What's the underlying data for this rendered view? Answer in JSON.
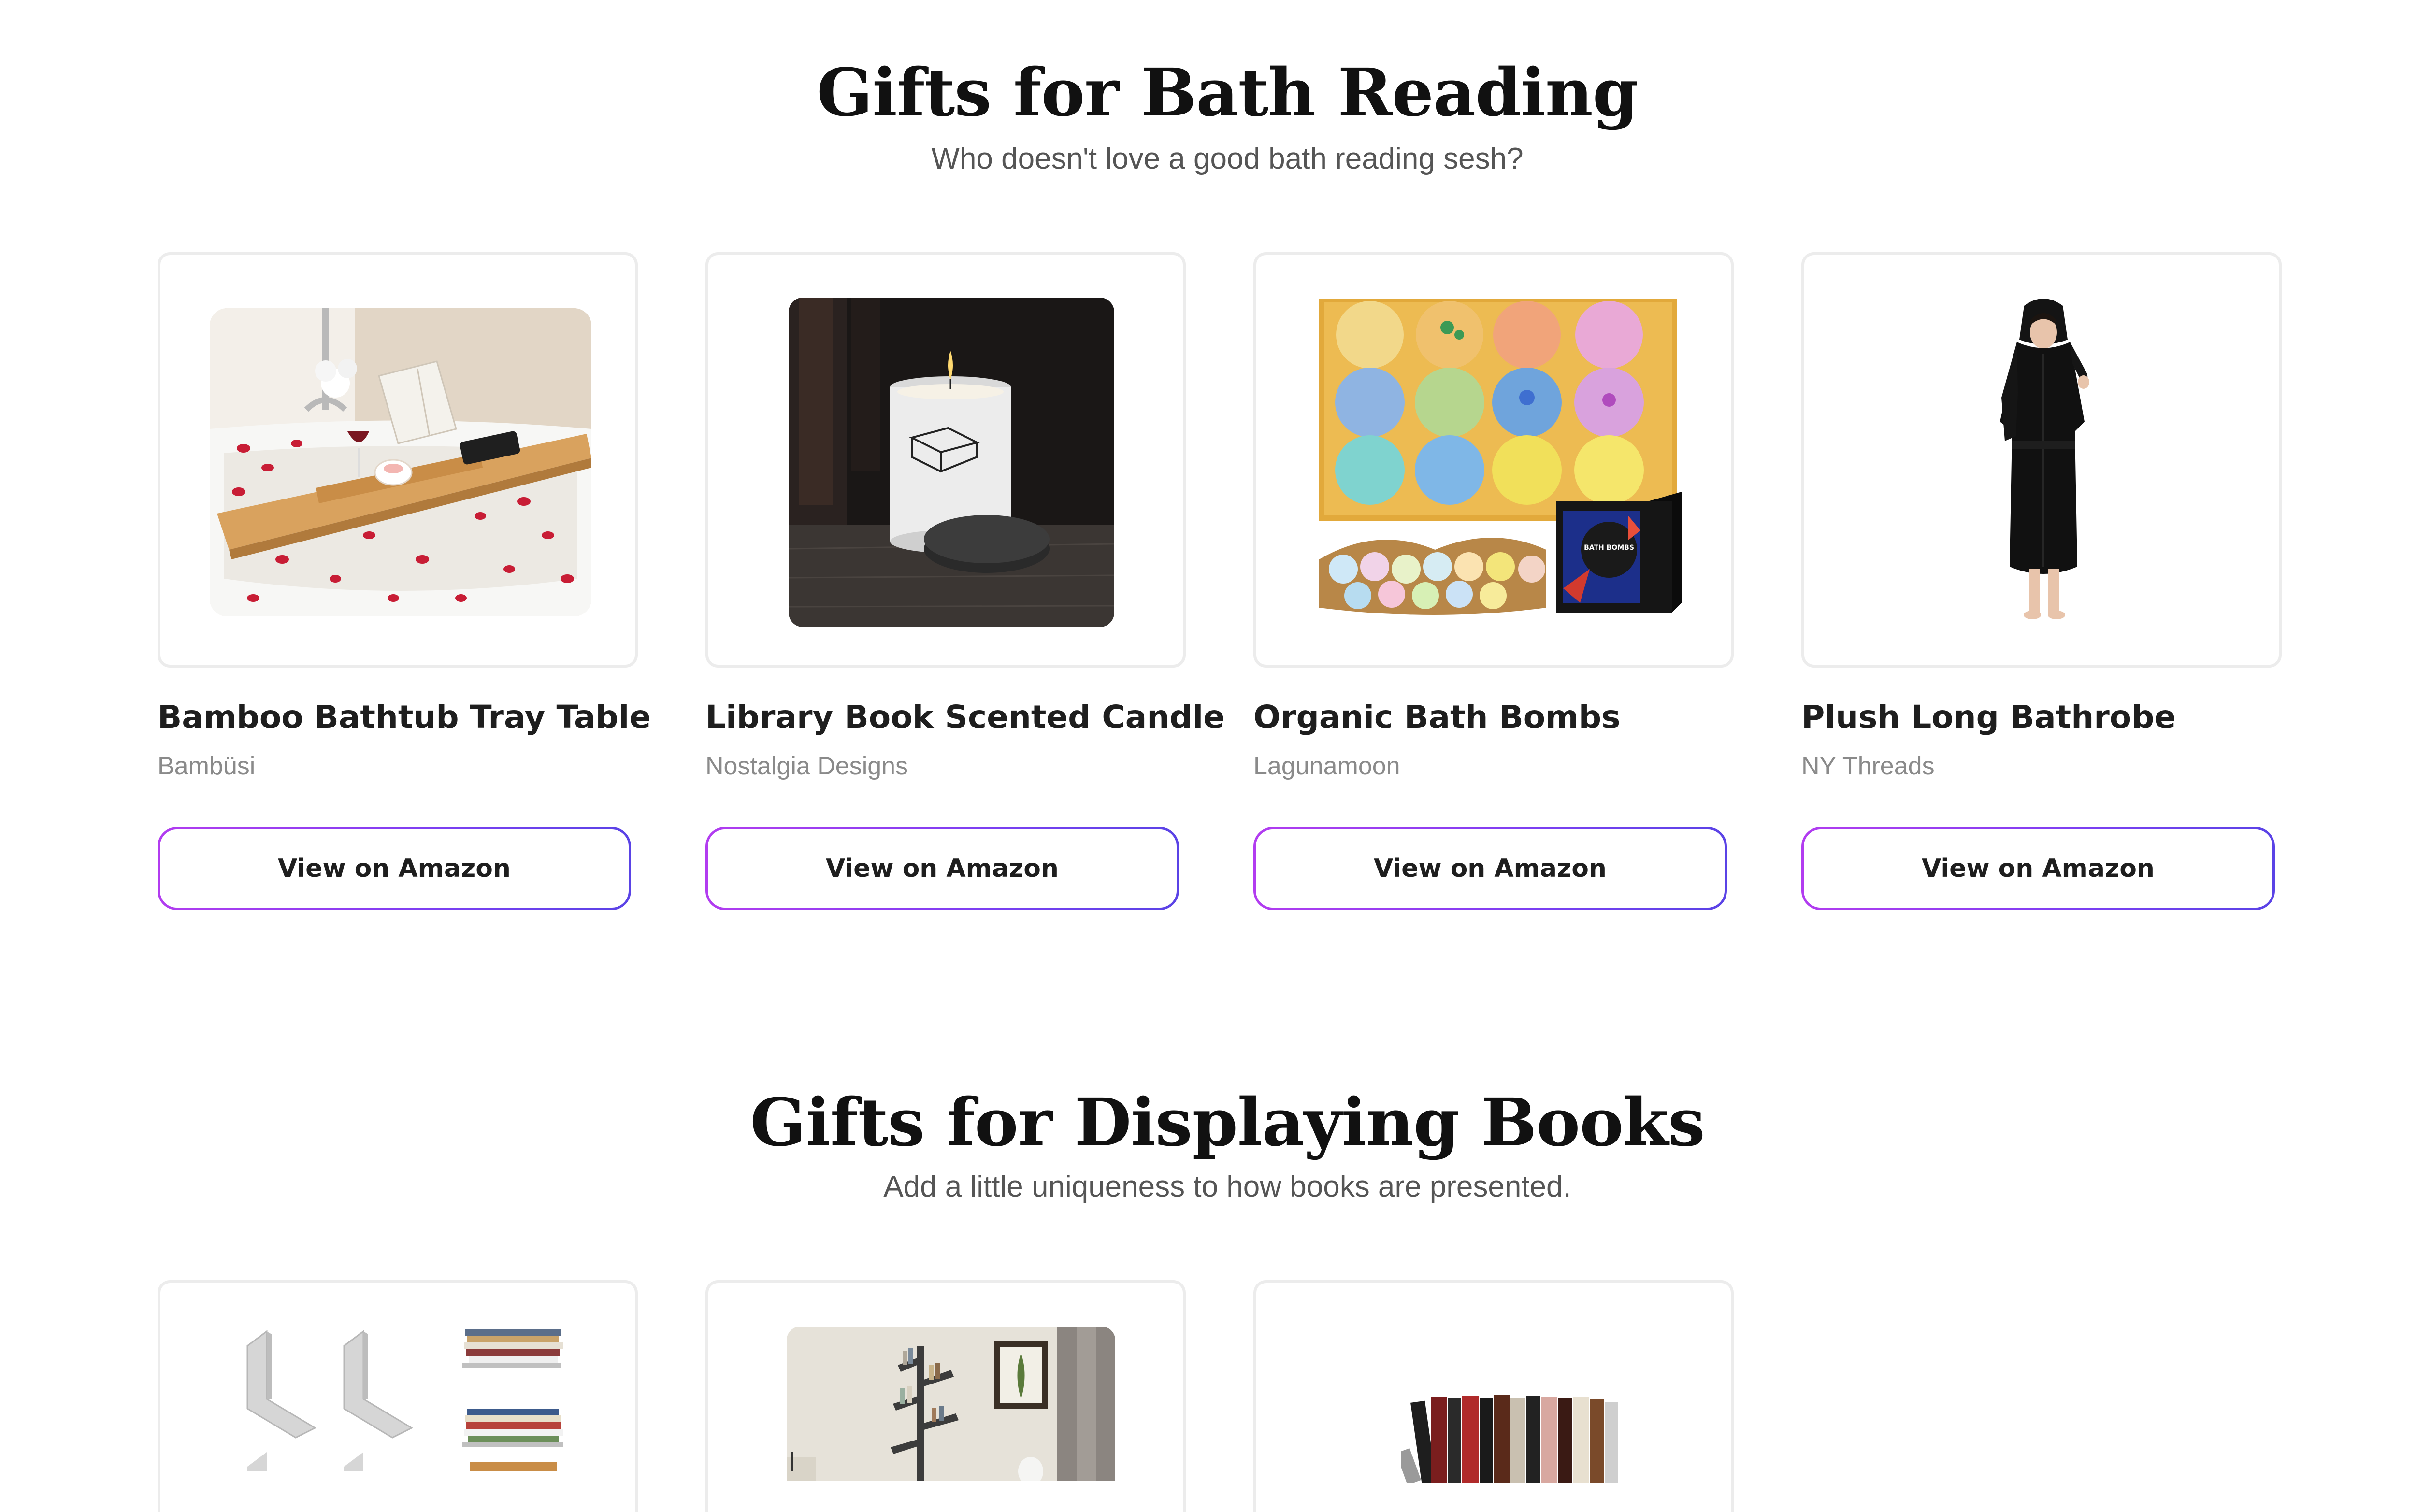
{
  "sections": [
    {
      "title": "Gifts for Bath Reading",
      "subtitle": "Who doesn't love a good bath reading sesh?",
      "products": [
        {
          "name": "Bamboo Bathtub Tray Table",
          "brand": "Bambüsi",
          "button": "View on Amazon"
        },
        {
          "name": "Library Book Scented Candle",
          "brand": "Nostalgia Designs",
          "button": "View on Amazon"
        },
        {
          "name": "Organic Bath Bombs",
          "brand": "Lagunamoon",
          "button": "View on Amazon",
          "box_label": "BATH BOMBS"
        },
        {
          "name": "Plush Long Bathrobe",
          "brand": "NY Threads",
          "button": "View on Amazon"
        }
      ]
    },
    {
      "title": "Gifts for Displaying Books",
      "subtitle": "Add a little uniqueness to how books are presented.",
      "products": [
        {
          "name": "",
          "brand": "",
          "button": ""
        },
        {
          "name": "",
          "brand": "",
          "button": ""
        },
        {
          "name": "",
          "brand": "",
          "button": ""
        }
      ]
    }
  ]
}
